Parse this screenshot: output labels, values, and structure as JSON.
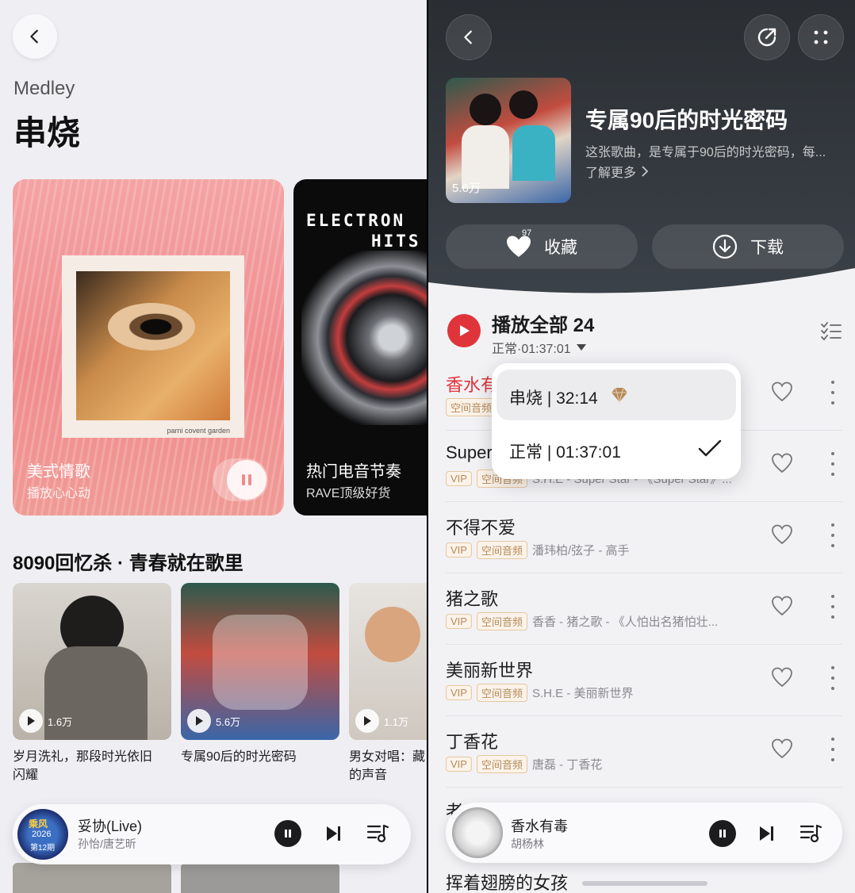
{
  "left": {
    "subtitle": "Medley",
    "title": "串烧",
    "cards": [
      {
        "title": "美式情歌",
        "subtitle": "播放心心动",
        "art_caption": "parni covent garden"
      },
      {
        "title": "热门电音节奏",
        "subtitle": "RAVE顶级好货",
        "art_text_line1": "ELECTRON",
        "art_text_line2": "HITS"
      }
    ],
    "section_title": "8090回忆杀 · 青春就在歌里",
    "playlists": [
      {
        "count": "1.6万",
        "title_line1": "岁月洗礼，那段时光依旧",
        "title_line2": "闪耀"
      },
      {
        "count": "5.6万",
        "title_line1": "专属90后的时光密码",
        "title_line2": ""
      },
      {
        "count": "1.1万",
        "title_line1": "男女对唱：藏",
        "title_line2": "的声音"
      }
    ],
    "player": {
      "song": "妥协(Live)",
      "artist": "孙怡/唐艺昕",
      "badge_line1": "乘风",
      "badge_line2": "2026",
      "badge_line3": "第12期"
    }
  },
  "right": {
    "cover_count": "5.6万",
    "playlist_title": "专属90后的时光密码",
    "playlist_desc": "这张歌曲，是专属于90后的时光密码，每...",
    "learn_more": "了解更多",
    "collect_label": "收藏",
    "collect_count": "97",
    "download_label": "下载",
    "play_all_label": "播放全部 24",
    "mode_label": "正常·01:37:01",
    "dropdown": {
      "option1": "串烧 | 32:14",
      "option2": "正常 | 01:37:01"
    },
    "songs": [
      {
        "title": "香水有毒",
        "tags": [
          "空间音频"
        ],
        "meta": ""
      },
      {
        "title": "Super Star",
        "tags": [
          "VIP",
          "空间音频"
        ],
        "meta": "S.H.E - Super Star - 《Super Star》..."
      },
      {
        "title": "不得不爱",
        "tags": [
          "VIP",
          "空间音频"
        ],
        "meta": "潘玮柏/弦子 - 高手"
      },
      {
        "title": "猪之歌",
        "tags": [
          "VIP",
          "空间音频"
        ],
        "meta": "香香 - 猪之歌 - 《人怕出名猪怕壮..."
      },
      {
        "title": "美丽新世界",
        "tags": [
          "VIP",
          "空间音频"
        ],
        "meta": "S.H.E - 美丽新世界"
      },
      {
        "title": "丁香花",
        "tags": [
          "VIP",
          "空间音频"
        ],
        "meta": "唐磊 - 丁香花"
      }
    ],
    "last_song_peek": "老",
    "bottom_song": "挥着翅膀的女孩",
    "player": {
      "song": "香水有毒",
      "artist": "胡杨林"
    }
  },
  "colors": {
    "accent_red": "#e0343b",
    "vip_gold": "#b58a5a"
  }
}
